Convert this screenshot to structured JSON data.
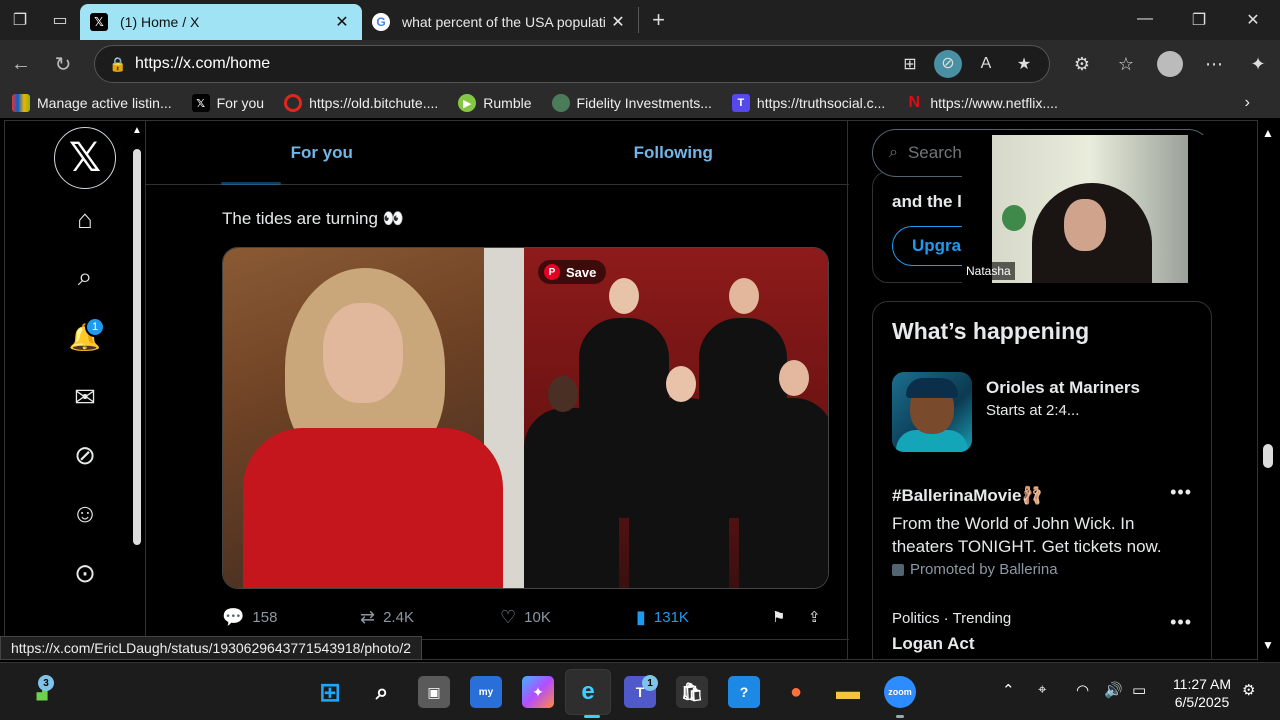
{
  "browser": {
    "tabs": [
      {
        "title": "(1) Home / X",
        "favicon": "X",
        "active": true
      },
      {
        "title": "what percent of the USA populati",
        "favicon": "G",
        "active": false
      }
    ],
    "url": "https://x.com/home",
    "bookmarks": [
      {
        "label": "Manage active listin...",
        "icon": "ebay-icon"
      },
      {
        "label": "For you",
        "icon": "x-icon"
      },
      {
        "label": "https://old.bitchute....",
        "icon": "bitchute-icon"
      },
      {
        "label": "Rumble",
        "icon": "rumble-icon"
      },
      {
        "label": "Fidelity Investments...",
        "icon": "fidelity-icon"
      },
      {
        "label": "https://truthsocial.c...",
        "icon": "truthsocial-icon"
      },
      {
        "label": "https://www.netflix....",
        "icon": "netflix-icon"
      }
    ],
    "status_url": "https://x.com/EricLDaugh/status/1930629643771543918/photo/2"
  },
  "nav": {
    "notification_count": "1"
  },
  "feed": {
    "tabs": [
      {
        "label": "For you"
      },
      {
        "label": "Following"
      }
    ],
    "tweet": {
      "text": "The tides are turning 👀",
      "save_label": "Save",
      "replies": "158",
      "reposts": "2.4K",
      "likes": "10K",
      "views": "131K"
    }
  },
  "sidebar": {
    "search_placeholder": "Search",
    "premium_text": "and the l",
    "premium_button": "Upgra",
    "happening_title": "What’s happening",
    "trends": [
      {
        "title": "Orioles at Mariners",
        "sub": "Starts at 2:4..."
      },
      {
        "title": "#BallerinaMovie🩰",
        "sub": "From the World of John Wick. In theaters TONIGHT. Get tickets now.",
        "meta": "Promoted by Ballerina"
      },
      {
        "meta": "Politics · Trending",
        "title": "Logan Act"
      }
    ]
  },
  "webcam": {
    "name": "Natasha"
  },
  "taskbar": {
    "widget_badge": "3",
    "teams_badge": "1",
    "time": "11:27 AM",
    "date": "6/5/2025"
  },
  "colors": {
    "accent": "#1d9bf0",
    "tab_active": "#9fe3f5",
    "background": "#000000"
  }
}
